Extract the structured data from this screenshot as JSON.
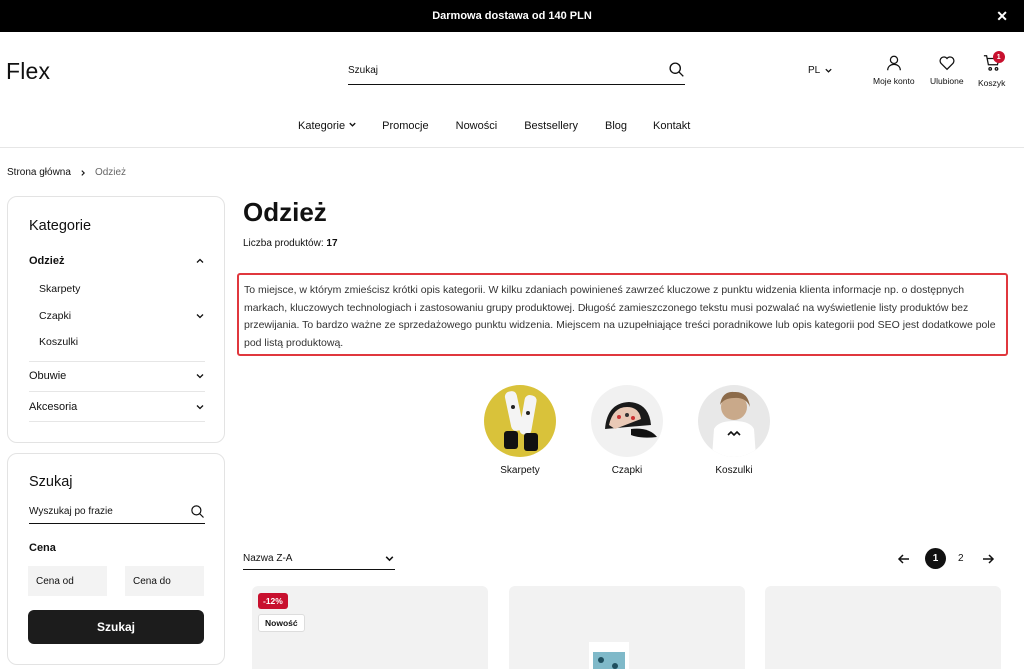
{
  "announcement": {
    "text": "Darmowa dostawa od 140 PLN"
  },
  "brand": {
    "logo": "Flex"
  },
  "search": {
    "placeholder": "Szukaj"
  },
  "language": {
    "code": "PL"
  },
  "header_actions": [
    {
      "label": "Moje konto",
      "icon": "user-icon"
    },
    {
      "label": "Ulubione",
      "icon": "heart-icon"
    },
    {
      "label": "Koszyk",
      "icon": "cart-icon",
      "badge": "1"
    }
  ],
  "nav": {
    "items": [
      "Kategorie",
      "Promocje",
      "Nowości",
      "Bestsellery",
      "Blog",
      "Kontakt"
    ]
  },
  "breadcrumb": {
    "home": "Strona główna",
    "current": "Odzież"
  },
  "sidebar": {
    "categories_title": "Kategorie",
    "categories": [
      {
        "label": "Odzież"
      },
      {
        "label": "Skarpety"
      },
      {
        "label": "Czapki"
      },
      {
        "label": "Koszulki"
      },
      {
        "label": "Obuwie"
      },
      {
        "label": "Akcesoria"
      }
    ],
    "search_title": "Szukaj",
    "phrase_placeholder": "Wyszukaj po frazie",
    "price_title": "Cena",
    "price_from_placeholder": "Cena od",
    "price_to_placeholder": "Cena do",
    "search_button": "Szukaj"
  },
  "main": {
    "title": "Odzież",
    "count_label": "Liczba produktów:",
    "count_value": "17",
    "description": "To miejsce, w którym zmieścisz krótki opis kategorii. W kilku zdaniach powinieneś zawrzeć kluczowe z punktu widzenia klienta informacje np. o dostępnych markach, kluczowych technologiach i zastosowaniu grupy produktowej. Długość zamieszczonego tekstu musi pozwalać na wyświetlenie listy produktów bez przewijania. To bardzo ważne ze sprzedażowego punktu widzenia. Miejscem na uzupełniające treści poradnikowe lub opis kategorii pod SEO jest dodatkowe pole pod listą produktową.",
    "subcategories": [
      {
        "label": "Skarpety"
      },
      {
        "label": "Czapki"
      },
      {
        "label": "Koszulki"
      }
    ],
    "sort_label": "Nazwa Z-A",
    "pagination": {
      "current": "1",
      "next": "2"
    },
    "product_tags": {
      "sale": "-12%",
      "new": "Nowość"
    }
  },
  "colors": {
    "accent": "#e0373d",
    "sale": "#c8102e",
    "dark": "#1c1c1c"
  }
}
